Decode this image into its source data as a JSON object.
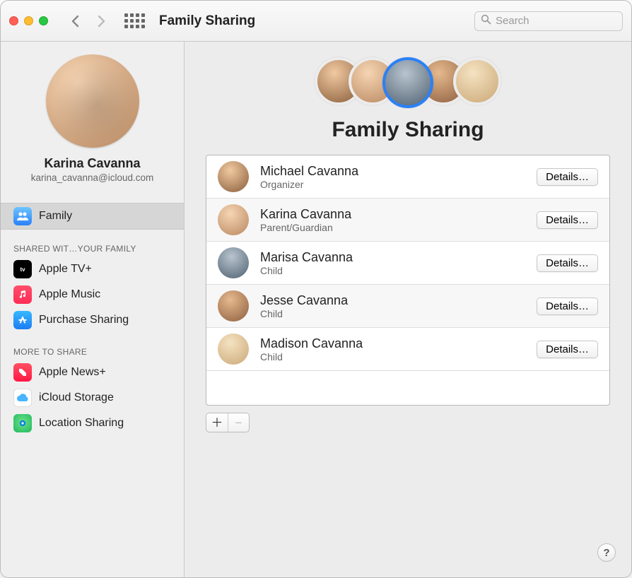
{
  "toolbar": {
    "title": "Family Sharing",
    "search_placeholder": "Search"
  },
  "profile": {
    "name": "Karina Cavanna",
    "email": "karina_cavanna@icloud.com"
  },
  "sidebar": {
    "family_label": "Family",
    "shared_header": "SHARED WIT…YOUR FAMILY",
    "more_header": "MORE TO SHARE",
    "shared_items": [
      {
        "label": "Apple TV+"
      },
      {
        "label": "Apple Music"
      },
      {
        "label": "Purchase Sharing"
      }
    ],
    "more_items": [
      {
        "label": "Apple News+"
      },
      {
        "label": "iCloud Storage"
      },
      {
        "label": "Location Sharing"
      }
    ]
  },
  "main": {
    "hero_title": "Family Sharing",
    "details_label": "Details…",
    "members": [
      {
        "name": "Michael Cavanna",
        "role": "Organizer"
      },
      {
        "name": "Karina Cavanna",
        "role": "Parent/Guardian"
      },
      {
        "name": "Marisa Cavanna",
        "role": "Child"
      },
      {
        "name": "Jesse Cavanna",
        "role": "Child"
      },
      {
        "name": "Madison Cavanna",
        "role": "Child"
      }
    ]
  }
}
